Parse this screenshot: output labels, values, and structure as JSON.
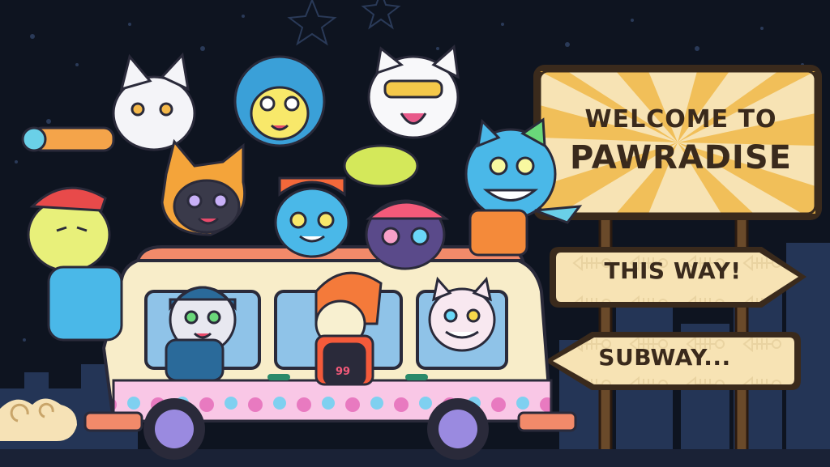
{
  "sign": {
    "line1": "WELCOME TO",
    "line2": "PAWRADISE"
  },
  "buttons": {
    "this_way": "THIS WAY!",
    "subway": "SUBWAY..."
  },
  "van": {
    "plate_number": "99"
  },
  "colors": {
    "sky": "#0e1420",
    "sign_face": "#f7e3b4",
    "sign_ray": "#f0b94a",
    "sign_outline": "#3a2a1c",
    "van_body": "#f8edc9",
    "van_roof": "#f28a6a",
    "city": "#243556"
  },
  "icons": [
    "star-icon",
    "cloud-swirl-icon",
    "fish-bone-icon",
    "cat-face-icon"
  ]
}
